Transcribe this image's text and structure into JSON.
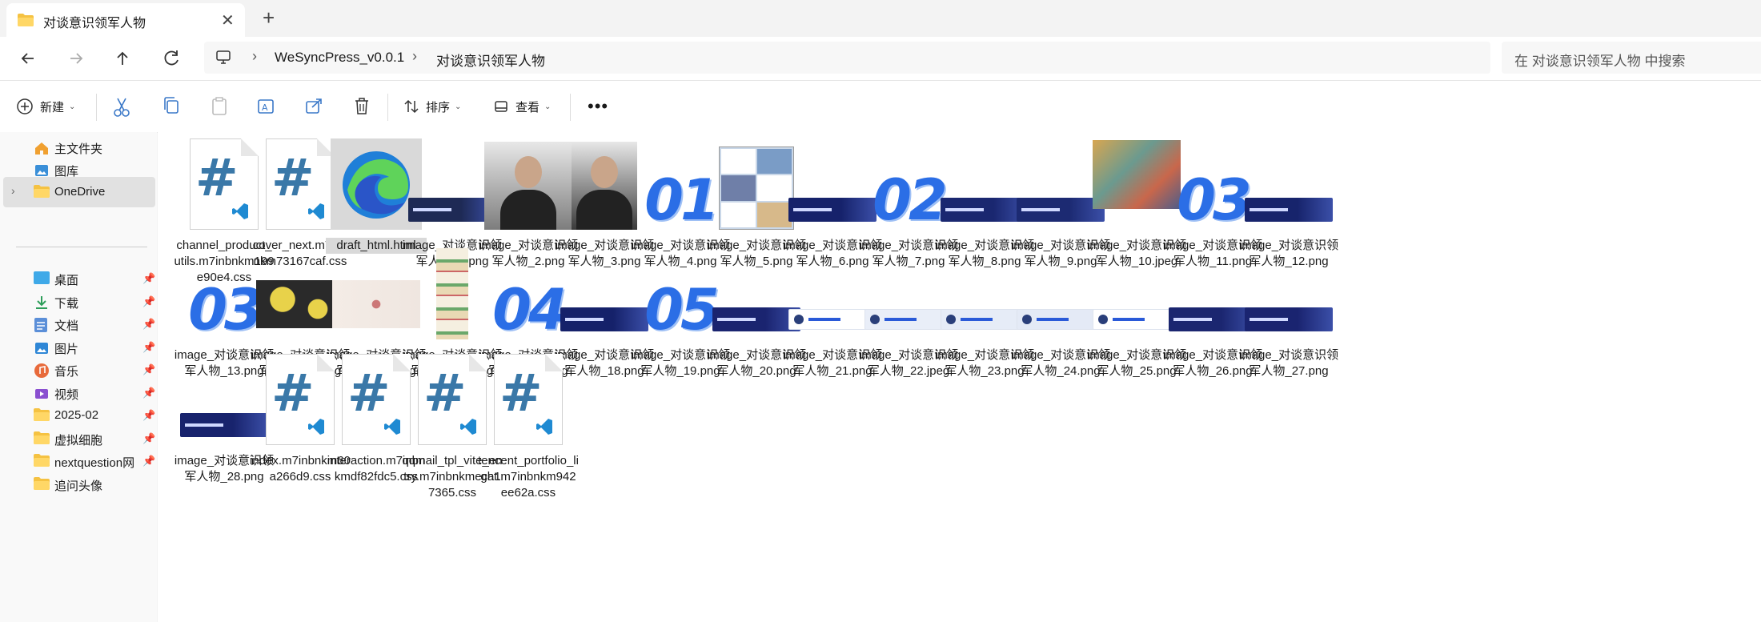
{
  "window": {
    "tab_title": "对谈意识领军人物"
  },
  "address": {
    "crumbs": [
      "WeSyncPress_v0.0.1",
      "对谈意识领军人物"
    ],
    "search_placeholder": "在 对谈意识领军人物 中搜索"
  },
  "toolbar": {
    "new_label": "新建",
    "sort_label": "排序",
    "view_label": "查看"
  },
  "sidebar": {
    "top": [
      {
        "label": "主文件夹",
        "icon": "home-icon"
      },
      {
        "label": "图库",
        "icon": "gallery-icon"
      },
      {
        "label": "OneDrive",
        "icon": "folder-icon",
        "selected": true
      }
    ],
    "pinned": [
      {
        "label": "桌面",
        "icon": "desktop-icon"
      },
      {
        "label": "下载",
        "icon": "download-icon"
      },
      {
        "label": "文档",
        "icon": "documents-icon"
      },
      {
        "label": "图片",
        "icon": "pictures-icon"
      },
      {
        "label": "音乐",
        "icon": "music-icon"
      },
      {
        "label": "视频",
        "icon": "video-icon"
      },
      {
        "label": "2025-02",
        "icon": "folder-icon"
      },
      {
        "label": "虚拟细胞",
        "icon": "folder-icon"
      },
      {
        "label": "nextquestion网",
        "icon": "folder-icon"
      },
      {
        "label": "追问头像",
        "icon": "folder-icon"
      }
    ]
  },
  "files": [
    {
      "name": "channel_product_utils.m7inbnkm199e90e4.css",
      "kind": "css"
    },
    {
      "name": "cover_next.m7inbnkm73167caf.css",
      "kind": "css"
    },
    {
      "name": "draft_html.html",
      "kind": "edge",
      "selected": true
    },
    {
      "name": "image_对谈意识领军人物_1.png",
      "kind": "banner",
      "color": "#1e2a55"
    },
    {
      "name": "image_对谈意识领军人物_2.png",
      "kind": "photo",
      "color": "#7d7d7d"
    },
    {
      "name": "image_对谈意识领军人物_3.png",
      "kind": "photo",
      "color": "#3a3a3a"
    },
    {
      "name": "image_对谈意识领军人物_4.png",
      "kind": "num",
      "text": "01"
    },
    {
      "name": "image_对谈意识领军人物_5.png",
      "kind": "comic",
      "color": "#c9d7e8"
    },
    {
      "name": "image_对谈意识领军人物_6.png",
      "kind": "banner",
      "color": "#16226b"
    },
    {
      "name": "image_对谈意识领军人物_7.png",
      "kind": "num",
      "text": "02"
    },
    {
      "name": "image_对谈意识领军人物_8.png",
      "kind": "banner",
      "color": "#1a2770"
    },
    {
      "name": "image_对谈意识领军人物_9.png",
      "kind": "banner",
      "color": "#1c2a72"
    },
    {
      "name": "image_对谈意识领军人物_10.jpeg",
      "kind": "art",
      "color": "#b98a4e"
    },
    {
      "name": "image_对谈意识领军人物_11.png",
      "kind": "num",
      "text": "03"
    },
    {
      "name": "image_对谈意识领军人物_12.png",
      "kind": "banner",
      "color": "#17246c"
    },
    {
      "name": "image_对谈意识领军人物_13.png",
      "kind": "num",
      "text": "03"
    },
    {
      "name": "image_对谈意识领军人物_14.jpeg",
      "kind": "art",
      "color": "#2a2a2a"
    },
    {
      "name": "image_对谈意识领军人物_15.png",
      "kind": "art",
      "color": "#efe6e0"
    },
    {
      "name": "image_对谈意识领军人物_16.jpeg",
      "kind": "tall",
      "color": "#d8c9a4"
    },
    {
      "name": "image_对谈意识领军人物_17.png",
      "kind": "num",
      "text": "04"
    },
    {
      "name": "image_对谈意识领军人物_18.png",
      "kind": "banner",
      "color": "#15216a"
    },
    {
      "name": "image_对谈意识领军人物_19.png",
      "kind": "num",
      "text": "05"
    },
    {
      "name": "image_对谈意识领军人物_20.png",
      "kind": "banner",
      "color": "#1a2470"
    },
    {
      "name": "image_对谈意识领军人物_21.png",
      "kind": "lightbanner",
      "color": "#ffffff"
    },
    {
      "name": "image_对谈意识领军人物_22.jpeg",
      "kind": "lightbanner",
      "color": "#e9eef8"
    },
    {
      "name": "image_对谈意识领军人物_23.png",
      "kind": "lightbanner",
      "color": "#e6ecf7"
    },
    {
      "name": "image_对谈意识领军人物_24.png",
      "kind": "lightbanner",
      "color": "#e4eaf6"
    },
    {
      "name": "image_对谈意识领军人物_25.png",
      "kind": "lightbanner",
      "color": "#ffffff"
    },
    {
      "name": "image_对谈意识领军人物_26.png",
      "kind": "banner",
      "color": "#1b2670"
    },
    {
      "name": "image_对谈意识领军人物_27.png",
      "kind": "banner",
      "color": "#1a2470"
    },
    {
      "name": "image_对谈意识领军人物_28.png",
      "kind": "banner",
      "color": "#18236d"
    },
    {
      "name": "index.m7inbnkm60a266d9.css",
      "kind": "css"
    },
    {
      "name": "interaction.m7inbnkmdf82fdc5.css",
      "kind": "css"
    },
    {
      "name": "qqmail_tpl_vite_entry.m7inbnkmeca17365.css",
      "kind": "css"
    },
    {
      "name": "tencent_portfolio_light.m7inbnkm942ee62a.css",
      "kind": "css"
    }
  ]
}
